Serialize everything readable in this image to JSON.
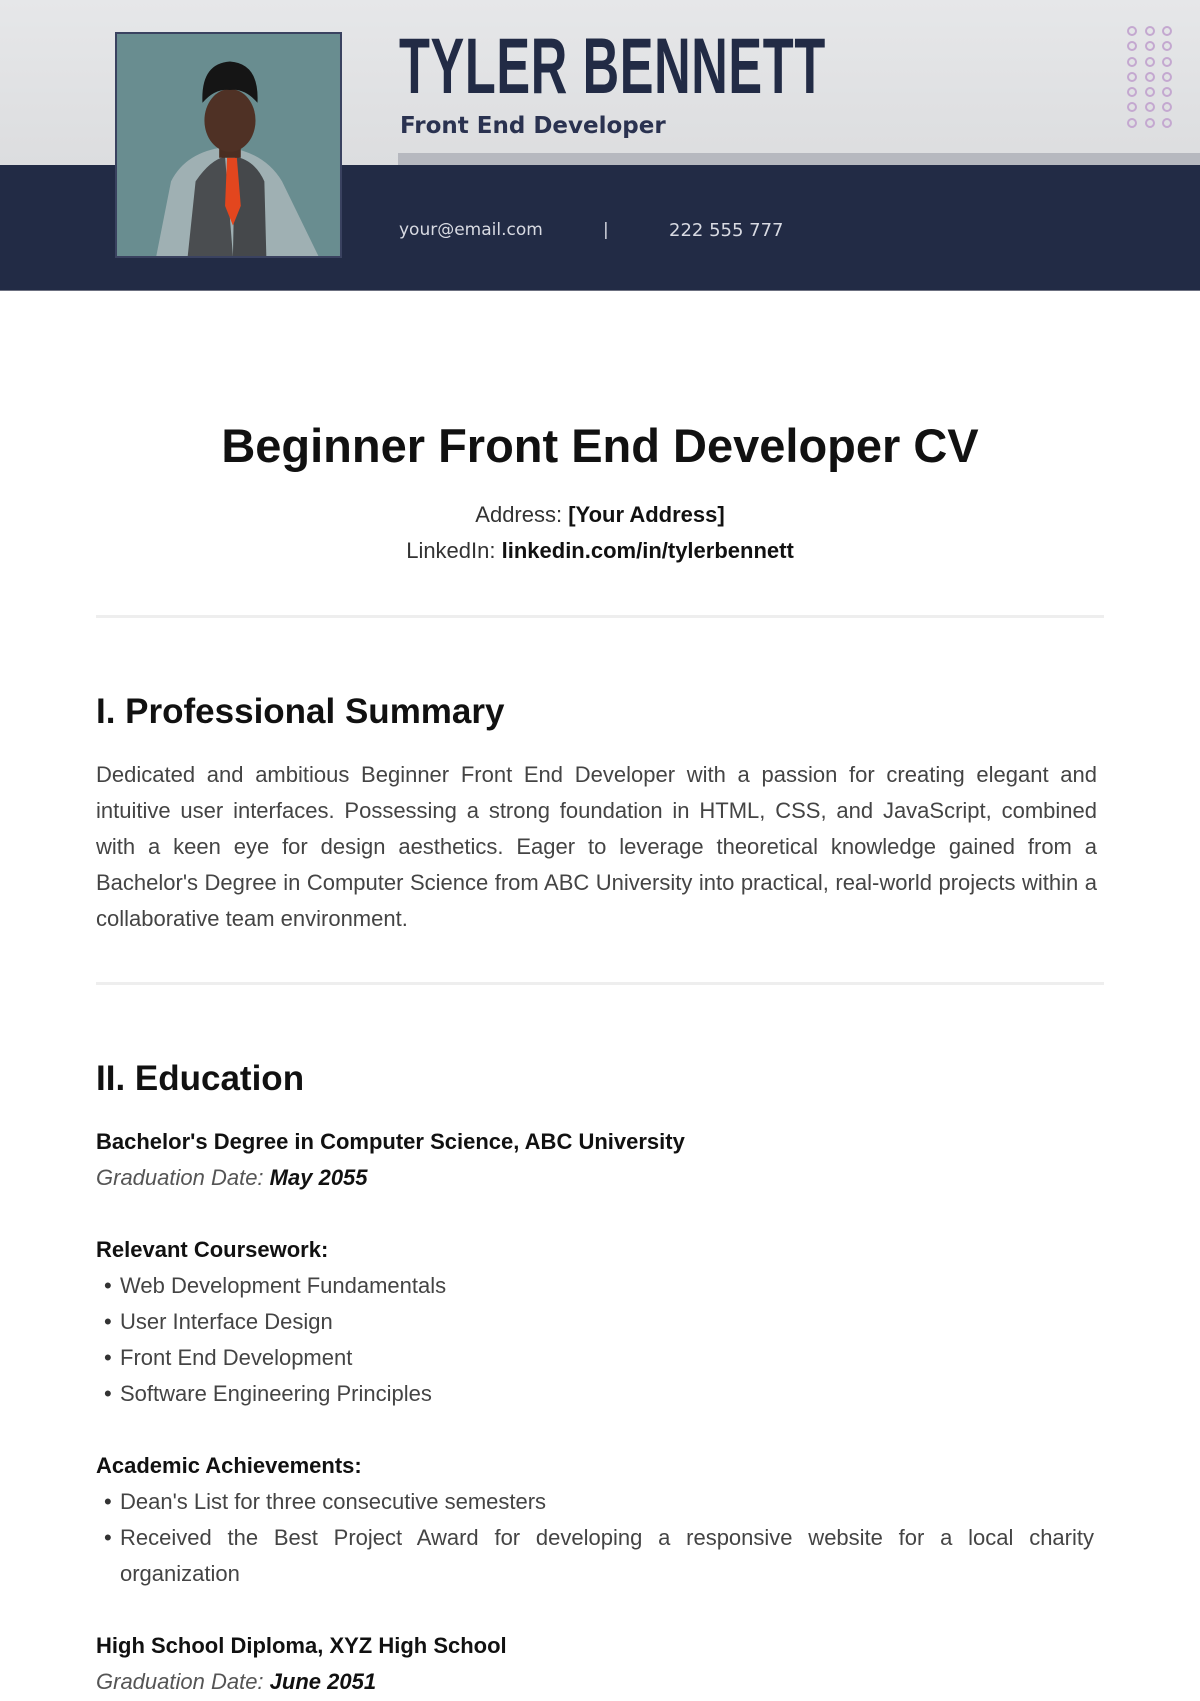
{
  "header": {
    "name": "TYLER BENNETT",
    "role": "Front End Developer",
    "email": "your@email.com",
    "separator": "|",
    "phone": "222 555 777",
    "photo_alt": "Portrait photo of Tyler Bennett",
    "colors": {
      "navy": "#222b45",
      "light_band": "#e2e3e5",
      "gray_bar": "#b6b8bf",
      "dot_accent": "#c4a8d0"
    }
  },
  "document": {
    "title": "Beginner Front End Developer CV",
    "address_label": "Address:",
    "address_value": "[Your Address]",
    "linkedin_label": "LinkedIn:",
    "linkedin_value": "linkedin.com/in/tylerbennett"
  },
  "sections": {
    "summary": {
      "heading": "I. Professional Summary",
      "text": "Dedicated and ambitious Beginner Front End Developer with a passion for creating elegant and intuitive user interfaces. Possessing a strong foundation in HTML, CSS, and JavaScript, combined with a keen eye for design aesthetics. Eager to leverage theoretical knowledge gained from a Bachelor's Degree in Computer Science from ABC University into practical, real-world projects within a collaborative team environment."
    },
    "education": {
      "heading": "II. Education",
      "degree": {
        "title": "Bachelor's Degree in Computer Science, ABC University",
        "date_label": "Graduation Date:",
        "date_value": "May 2055"
      },
      "coursework_label": "Relevant Coursework:",
      "coursework": [
        "Web Development Fundamentals",
        "User Interface Design",
        "Front End Development",
        "Software Engineering Principles"
      ],
      "achievements_label": "Academic Achievements:",
      "achievements": [
        "Dean's List for three consecutive semesters",
        "Received the Best Project Award for developing a responsive website for a local charity organization"
      ],
      "high_school": {
        "title": "High School Diploma, XYZ High School",
        "date_label": "Graduation Date:",
        "date_value": "June 2051"
      }
    }
  }
}
